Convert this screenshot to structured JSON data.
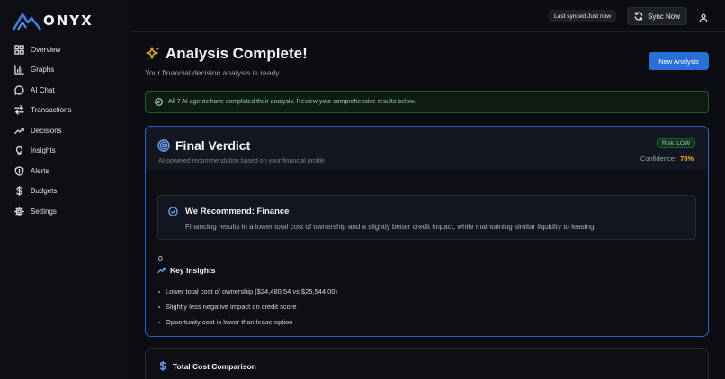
{
  "app": {
    "brand": "ONYX"
  },
  "sidebar": {
    "items": [
      {
        "label": "Overview",
        "icon": "overview-icon"
      },
      {
        "label": "Graphs",
        "icon": "bar-chart-icon"
      },
      {
        "label": "AI Chat",
        "icon": "chat-bubble-icon"
      },
      {
        "label": "Transactions",
        "icon": "swap-arrows-icon"
      },
      {
        "label": "Decisions",
        "icon": "trend-up-icon"
      },
      {
        "label": "Insights",
        "icon": "lightbulb-icon"
      },
      {
        "label": "Alerts",
        "icon": "shield-icon"
      },
      {
        "label": "Budgets",
        "icon": "dollar-icon"
      },
      {
        "label": "Settings",
        "icon": "gear-icon"
      }
    ]
  },
  "topbar": {
    "synced": "Last synced Just now",
    "sync_label": "Sync Now"
  },
  "main": {
    "title": "Analysis Complete!",
    "subtitle": "Your financial decision analysis is ready",
    "new_analysis": "New Analysis",
    "banner": "All 7 AI agents have completed their analysis. Review your comprehensive results below."
  },
  "verdict": {
    "title": "Final Verdict",
    "subtitle": "AI-powered recommendation based on your financial profile",
    "risk": "Risk: LOW",
    "confidence_label": "Confidence:",
    "confidence_value": "78%",
    "recommend_title": "We Recommend: Finance",
    "recommend_body": "Financing results in a lower total cost of ownership and a slightly better credit impact, while maintaining similar liquidity to leasing.",
    "count": "0",
    "insights_title": "Key Insights",
    "insights": [
      "Lower total cost of ownership ($24,480.54 vs $25,544.00)",
      "Slightly less negative impact on credit score",
      "Opportunity cost is lower than lease option"
    ]
  },
  "cost": {
    "title": "Total Cost Comparison"
  },
  "colors": {
    "accent": "#2a6fd6",
    "success": "#8bd7a4",
    "confidence": "#f0b42a",
    "verdict_border": "#2c63c9"
  }
}
